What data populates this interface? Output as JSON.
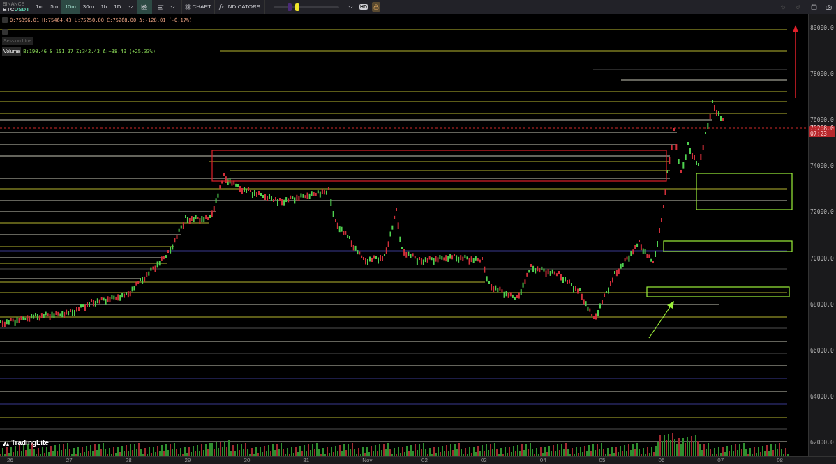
{
  "symbol": {
    "exchange": "BINANCE",
    "pair_base": "BTC",
    "pair_quote": "USDT"
  },
  "timeframes": [
    {
      "label": "1m",
      "selected": false
    },
    {
      "label": "5m",
      "selected": false
    },
    {
      "label": "15m",
      "selected": true
    },
    {
      "label": "30m",
      "selected": false
    },
    {
      "label": "1h",
      "selected": false
    },
    {
      "label": "1D",
      "selected": false
    }
  ],
  "toolbar": {
    "chart_type_selected": true,
    "chart_button": "CHART",
    "indicators_button": "INDICATORS",
    "indicators_prefix": "fx",
    "hd_badge": "HD",
    "lock_on": true
  },
  "slider": {
    "thumbs": [
      {
        "level": 0.21,
        "color": "#4a2a78"
      },
      {
        "level": 0.33,
        "color": "#f2e62a"
      }
    ]
  },
  "legend": {
    "ohlc": "O:75396.01 H:75464.43 L:75250.00 C:75268.00 Δ:-128.01 (-0.17%)",
    "session_line": "Session Line",
    "volume_label": "Volume",
    "volume_values": "B:190.46 S:151.97 Σ:342.43 Δ:+38.49 (+25.33%)"
  },
  "price_axis": [
    "80000.0",
    "78000.0",
    "76000.0",
    "74000.0",
    "72000.0",
    "70000.0",
    "68000.0",
    "66000.0",
    "64000.0",
    "62000.0"
  ],
  "current_price": {
    "price": "75268.0",
    "countdown": "07:23"
  },
  "time_axis": [
    "26",
    "27",
    "28",
    "29",
    "30",
    "31",
    "Nov",
    "02",
    "03",
    "04",
    "05",
    "06",
    "07",
    "08"
  ],
  "logo": "TradingLite"
}
